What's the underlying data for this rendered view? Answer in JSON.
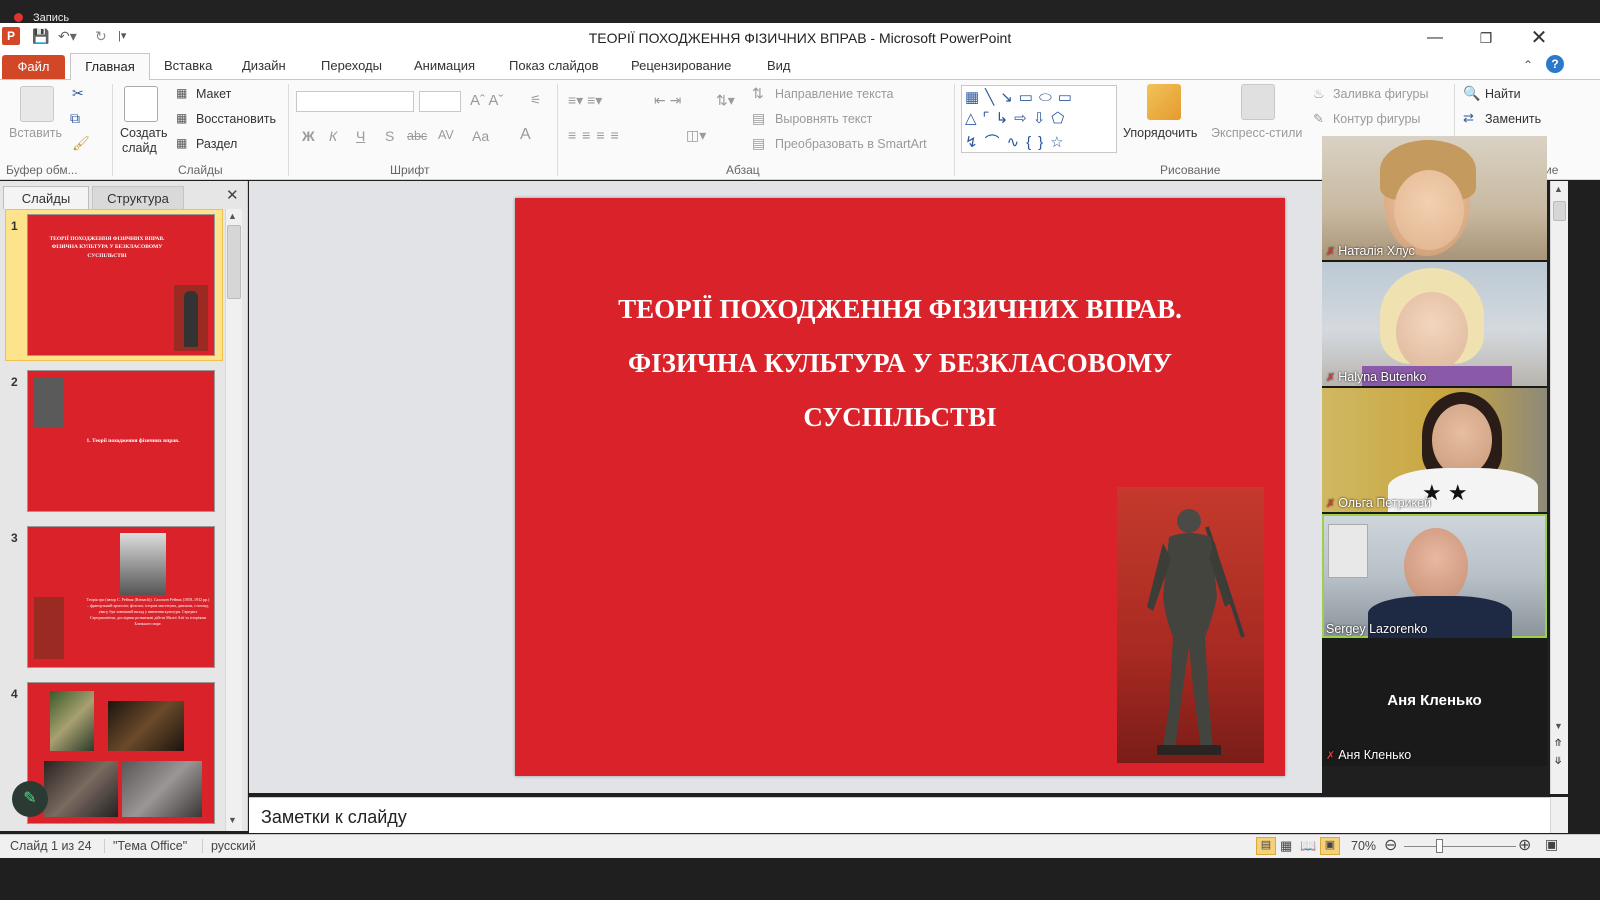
{
  "recording": {
    "label": "Запись"
  },
  "window": {
    "title": "ТЕОРІЇ ПОХОДЖЕННЯ ФІЗИЧНИХ ВПРАВ  -  Microsoft PowerPoint"
  },
  "tabs": {
    "file": "Файл",
    "items": [
      "Главная",
      "Вставка",
      "Дизайн",
      "Переходы",
      "Анимация",
      "Показ слайдов",
      "Рецензирование",
      "Вид"
    ]
  },
  "ribbon": {
    "clipboard": {
      "paste": "Вставить",
      "group": "Буфер обм..."
    },
    "slides": {
      "create_line1": "Создать",
      "create_line2": "слайд",
      "layout": "Макет",
      "reset": "Восстановить",
      "section": "Раздел",
      "group": "Слайды"
    },
    "font": {
      "group": "Шрифт",
      "bold": "Ж",
      "italic": "К",
      "underline": "Ч",
      "shadow": "S",
      "strike": "abc",
      "spacing": "AV",
      "case": "Aa",
      "color": "A"
    },
    "paragraph": {
      "group": "Абзац",
      "text_direction": "Направление текста",
      "align_text": "Выровнять текст",
      "smartart": "Преобразовать в SmartArt"
    },
    "drawing": {
      "group": "Рисование",
      "arrange": "Упорядочить",
      "quick_styles": "Экспресс-стили",
      "shape_fill": "Заливка фигуры",
      "shape_outline": "Контур фигуры"
    },
    "editing": {
      "find": "Найти",
      "replace": "Заменить",
      "group_partial": "ие"
    }
  },
  "leftpane": {
    "tab_slides": "Слайды",
    "tab_outline": "Структура",
    "thumbs": [
      {
        "num": "1",
        "text": "ТЕОРІЇ ПОХОДЖЕННЯ ФІЗИЧНИХ ВПРАВ. ФІЗИЧНА КУЛЬТУРА У БЕЗКЛАСОВОМУ СУСПІЛЬСТВІ"
      },
      {
        "num": "2",
        "text": "1. Теорії походження фізичних вправ."
      },
      {
        "num": "3",
        "text": "Теорія гри (автор С. Рейнак (Reinach)). Саломон Рейнак (1858–1932 рр.) – французький археолог, філолог, історик мистецтва, дивлячи, з погляд, увагу, був зовнішній вклад у вивчення культури. Середніх Середньовіччя, дослідник розвиткові дійств Малої Азії та історіями Близького маре."
      },
      {
        "num": "4",
        "text": ""
      }
    ]
  },
  "slide": {
    "title_line1": "ТЕОРІЇ ПОХОДЖЕННЯ ФІЗИЧНИХ ВПРАВ.",
    "title_line2": "ФІЗИЧНА КУЛЬТУРА У БЕЗКЛАСОВОМУ",
    "title_line3": "СУСПІЛЬСТВІ"
  },
  "notes": {
    "placeholder": "Заметки к слайду"
  },
  "status": {
    "slide": "Слайд 1 из 24",
    "theme": "\"Тема Office\"",
    "lang": "русский",
    "zoom": "70%"
  },
  "participants": [
    {
      "name": "Наталія Хлус",
      "muted": true
    },
    {
      "name": "Halyna Butenko",
      "muted": true
    },
    {
      "name": "Ольга Петрикей",
      "muted": true
    },
    {
      "name": "Sergey Lazorenko",
      "muted": false,
      "active": true
    },
    {
      "name": "Аня Кленько",
      "muted": true,
      "display": "Аня Кленько"
    }
  ],
  "colors": {
    "slide_red": "#d9222a",
    "file_tab": "#d24726",
    "active_speaker": "#9bd04a"
  }
}
